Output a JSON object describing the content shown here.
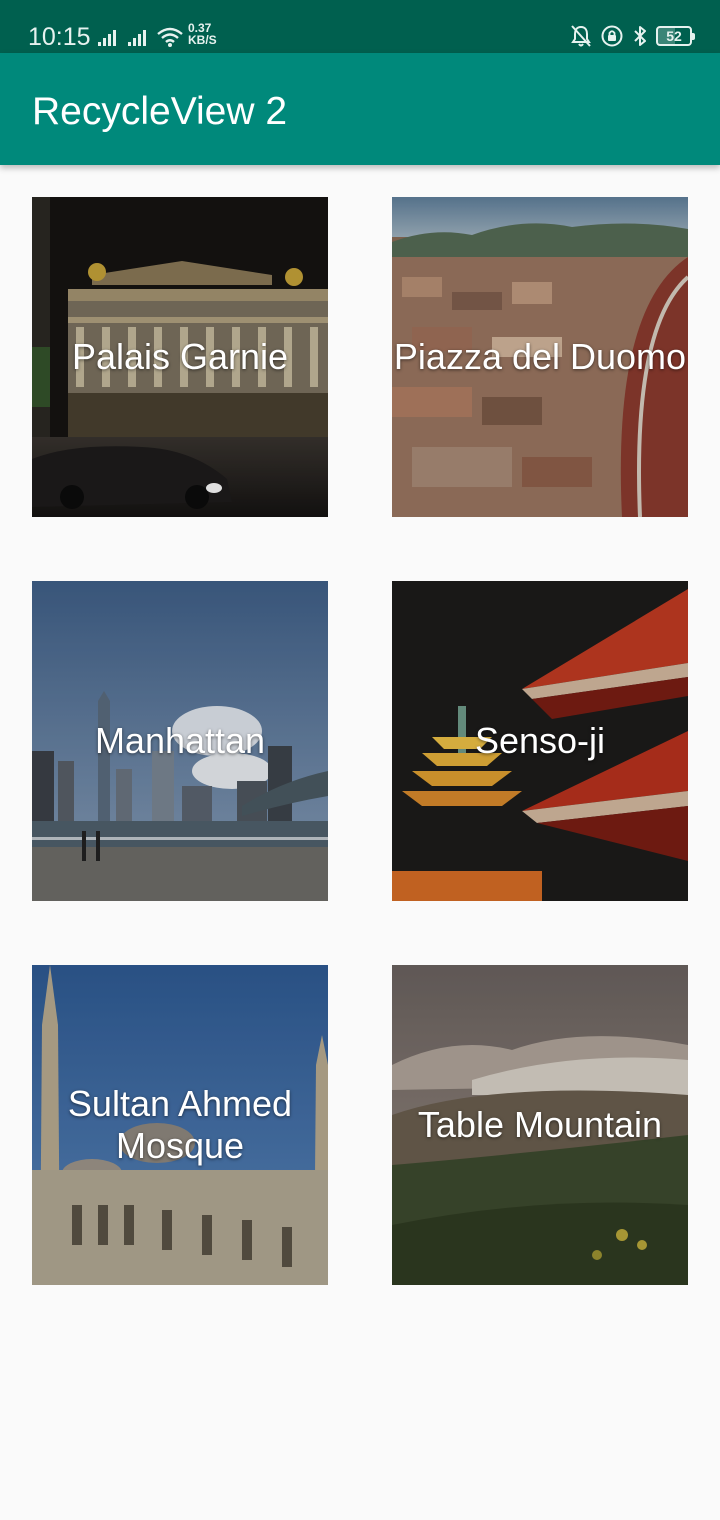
{
  "status_bar": {
    "time": "10:15",
    "net_speed_value": "0.37",
    "net_speed_unit": "KB/S",
    "battery": "52",
    "battery_level": 0.52
  },
  "app_bar": {
    "title": "RecycleView 2"
  },
  "places": [
    {
      "name": "Palais Garnie"
    },
    {
      "name": "Piazza del Duomo"
    },
    {
      "name": "Manhattan"
    },
    {
      "name": "Senso-ji"
    },
    {
      "name": "Sultan Ahmed Mosque"
    },
    {
      "name": "Table Mountain"
    }
  ],
  "colors": {
    "status_bar": "#00604f",
    "app_bar": "#00897b",
    "background": "#fafafa"
  }
}
